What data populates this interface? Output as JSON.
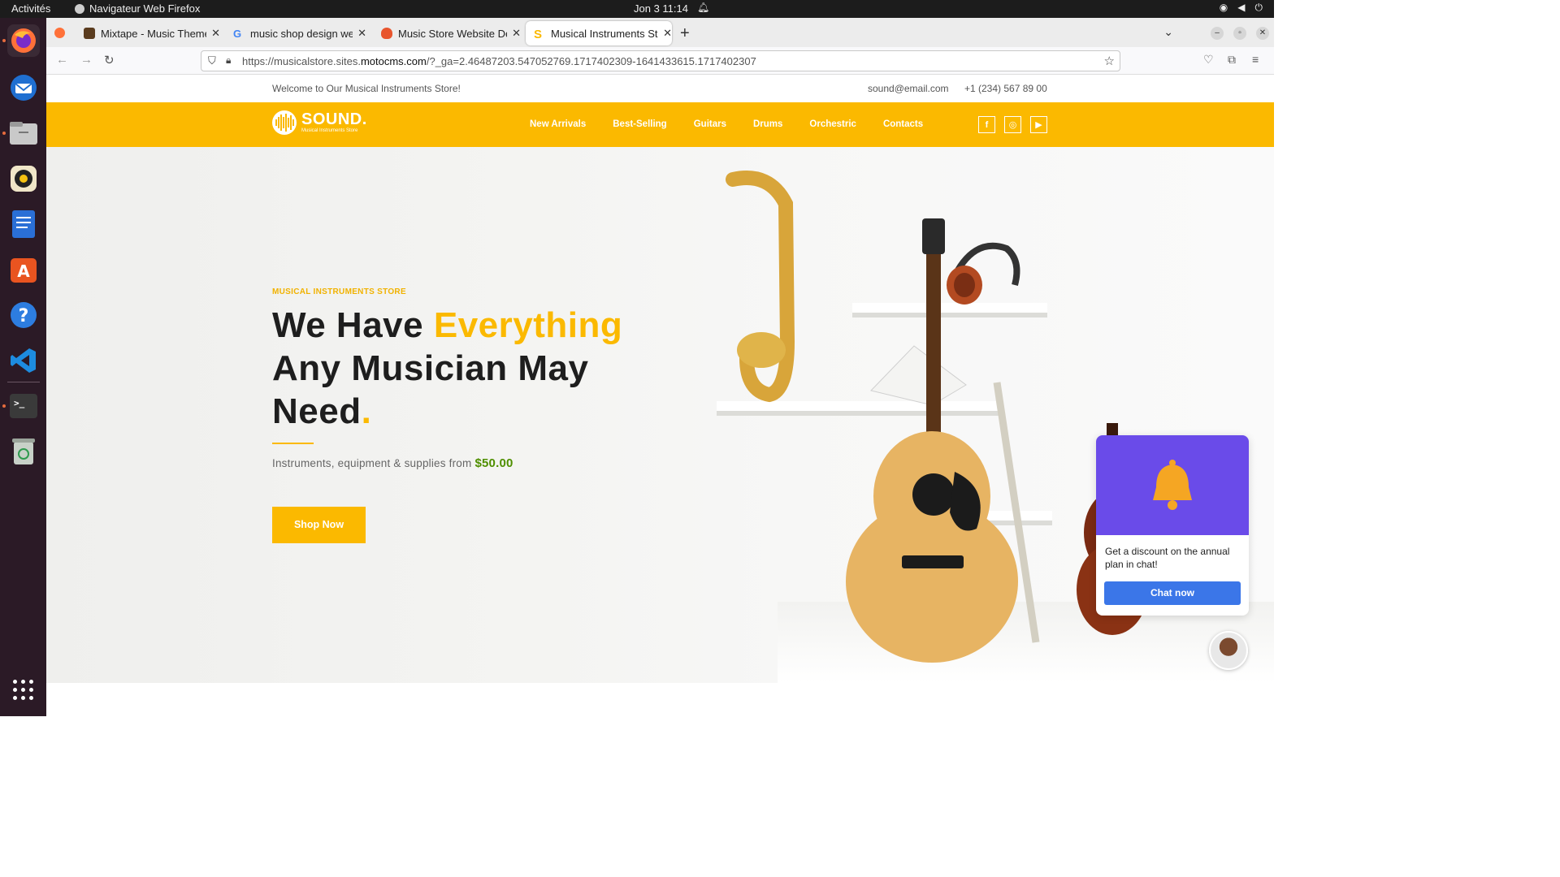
{
  "system": {
    "activities": "Activités",
    "app_name": "Navigateur Web Firefox",
    "clock": "Jon 3  11:14"
  },
  "tabs": [
    {
      "title": "Mixtape - Music Theme f",
      "favicon_color": "#5a3b1e"
    },
    {
      "title": "music shop design web -",
      "favicon_color": "#4285f4"
    },
    {
      "title": "Music Store Website Des",
      "favicon_color": "#e8552d"
    },
    {
      "title": "Musical Instruments Stor",
      "favicon_color": "#fbb900"
    }
  ],
  "url": {
    "prefix": "https://musicalstore.sites.",
    "domain": "motocms.com",
    "suffix": "/?_ga=2.46487203.547052769.1717402309-1641433615.1717402307"
  },
  "site": {
    "welcome": "Welcome to Our Musical Instruments Store!",
    "email": "sound@email.com",
    "phone": "+1 (234) 567 89 00",
    "logo_name": "SOUND.",
    "logo_sub": "Musical Instruments Store",
    "menu": [
      "New Arrivals",
      "Best-Selling",
      "Guitars",
      "Drums",
      "Orchestric",
      "Contacts"
    ],
    "social": [
      "f",
      "◎",
      "▶"
    ]
  },
  "hero": {
    "kicker": "MUSICAL INSTRUMENTS STORE",
    "line1_a": "We Have ",
    "line1_b": "Everything",
    "line2": "Any Musician May",
    "line3": "Need",
    "dot": ".",
    "sub": "Instruments, equipment & supplies from",
    "price": "$50.00",
    "cta": "Shop Now"
  },
  "chat": {
    "message": "Get a discount on the annual plan in chat!",
    "button": "Chat now"
  },
  "colors": {
    "brand": "#fbb900",
    "price": "#4f8f00",
    "chat_header": "#6a4be9",
    "chat_button": "#3b76e8"
  }
}
